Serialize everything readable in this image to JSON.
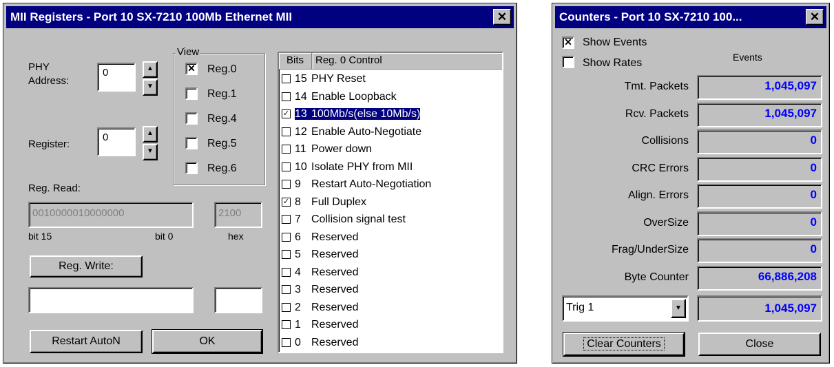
{
  "mii_window": {
    "title": "MII Registers - Port 10 SX-7210 100Mb Ethernet MII",
    "close_glyph": "✕",
    "phy_address_label_1": "PHY",
    "phy_address_label_2": "Address:",
    "phy_address_value": "0",
    "register_label": "Register:",
    "register_value": "0",
    "view_group_label": "View",
    "view_options": [
      {
        "label": "Reg.0",
        "checked": true
      },
      {
        "label": "Reg.1",
        "checked": false
      },
      {
        "label": "Reg.4",
        "checked": false
      },
      {
        "label": "Reg.5",
        "checked": false
      },
      {
        "label": "Reg.6",
        "checked": false
      }
    ],
    "reg_read_label": "Reg. Read:",
    "reg_read_binary": "0010000010000000",
    "reg_read_hex": "2100",
    "bit15_label": "bit 15",
    "bit0_label": "bit 0",
    "hex_label": "hex",
    "reg_write_button": "Reg. Write:",
    "write_binary_value": "",
    "write_hex_value": "",
    "restart_button": "Restart AutoN",
    "ok_button": "OK",
    "bits_header": "Bits",
    "reg_header": "Reg. 0 Control",
    "bits": [
      {
        "num": "15",
        "label": "PHY Reset",
        "checked": false
      },
      {
        "num": "14",
        "label": "Enable Loopback",
        "checked": false
      },
      {
        "num": "13",
        "label": "100Mb/s(else 10Mb/s)",
        "checked": true,
        "selected": true
      },
      {
        "num": "12",
        "label": "Enable Auto-Negotiate",
        "checked": false
      },
      {
        "num": "11",
        "label": "Power down",
        "checked": false
      },
      {
        "num": "10",
        "label": "Isolate PHY from MII",
        "checked": false
      },
      {
        "num": "9",
        "label": "Restart Auto-Negotiation",
        "checked": false
      },
      {
        "num": "8",
        "label": "Full Duplex",
        "checked": true
      },
      {
        "num": "7",
        "label": "Collision signal test",
        "checked": false
      },
      {
        "num": "6",
        "label": "Reserved",
        "checked": false
      },
      {
        "num": "5",
        "label": "Reserved",
        "checked": false
      },
      {
        "num": "4",
        "label": "Reserved",
        "checked": false
      },
      {
        "num": "3",
        "label": "Reserved",
        "checked": false
      },
      {
        "num": "2",
        "label": "Reserved",
        "checked": false
      },
      {
        "num": "1",
        "label": "Reserved",
        "checked": false
      },
      {
        "num": "0",
        "label": "Reserved",
        "checked": false
      }
    ]
  },
  "counters_window": {
    "title": "Counters - Port 10 SX-7210 100...",
    "close_glyph": "✕",
    "show_events_label": "Show Events",
    "show_events_checked": true,
    "show_rates_label": "Show Rates",
    "show_rates_checked": false,
    "events_header": "Events",
    "rows": [
      {
        "label": "Tmt. Packets",
        "value": "1,045,097"
      },
      {
        "label": "Rcv. Packets",
        "value": "1,045,097"
      },
      {
        "label": "Collisions",
        "value": "0"
      },
      {
        "label": "CRC Errors",
        "value": "0"
      },
      {
        "label": "Align. Errors",
        "value": "0"
      },
      {
        "label": "OverSize",
        "value": "0"
      },
      {
        "label": "Frag/UnderSize",
        "value": "0"
      },
      {
        "label": "Byte Counter",
        "value": "66,886,208"
      }
    ],
    "trig_select_value": "Trig 1",
    "trig_value": "1,045,097",
    "clear_button": "Clear Counters",
    "close_button": "Close"
  },
  "colors": {
    "title_bar": "#000080",
    "window_face": "#c0c0c0",
    "counter_value": "#0000ff"
  }
}
